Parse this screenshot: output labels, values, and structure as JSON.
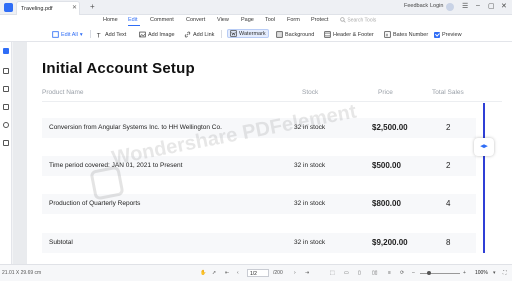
{
  "window": {
    "tab_title": "Traveling.pdf",
    "feedback": "Feedback",
    "login": "Login"
  },
  "menu": {
    "items": [
      "Home",
      "Edit",
      "Comment",
      "Convert",
      "View",
      "Page",
      "Tool",
      "Form",
      "Protect"
    ],
    "active": "Edit",
    "search_placeholder": "Search Tools"
  },
  "toolbar": {
    "edit_all": "Edit All",
    "add_text": "Add Text",
    "add_image": "Add Image",
    "add_link": "Add Link",
    "watermark": "Watermark",
    "background": "Background",
    "header_footer": "Header & Footer",
    "bates_number": "Bates Number",
    "preview": "Preview"
  },
  "document": {
    "title": "Initial Account Setup",
    "columns": [
      "Product Name",
      "Stock",
      "Price",
      "Total Sales"
    ],
    "rows": [
      {
        "name": "Conversion from Angular Systems Inc. to HH Wellington Co.",
        "stock": "32 in stock",
        "price": "$2,500.00",
        "sales": "2"
      },
      {
        "name": "Time period covered: JAN 01, 2021 to Present",
        "stock": "32 in stock",
        "price": "$500.00",
        "sales": "2"
      },
      {
        "name": "Production of Quarterly Reports",
        "stock": "32 in stock",
        "price": "$800.00",
        "sales": "4"
      },
      {
        "name": "Subtotal",
        "stock": "32 in stock",
        "price": "$9,200.00",
        "sales": "8"
      }
    ],
    "watermark_text": "Wondershare PDFelement"
  },
  "status": {
    "dimensions": "21.01 X 29.69 cm",
    "current_page": "1/2",
    "total_pages": "/200",
    "zoom": "100%"
  },
  "colors": {
    "accent": "#2f6df6",
    "compare_line": "#2f3fd6"
  }
}
